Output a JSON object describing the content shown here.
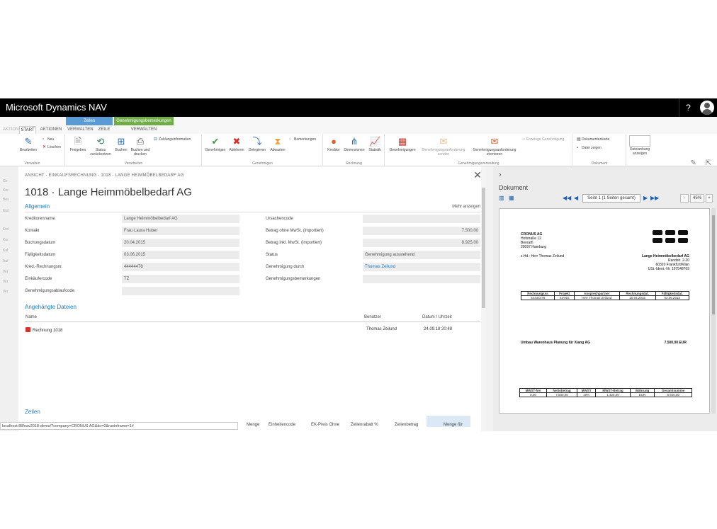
{
  "app": {
    "title": "Microsoft Dynamics NAV",
    "help": "?"
  },
  "ribbon": {
    "context_groups": [
      {
        "label": "Zeilen",
        "color": "#5b9bd5"
      },
      {
        "label": "Genehmigungsbemerkungen",
        "color": "#70ad47"
      }
    ],
    "tabs": [
      "AKTIONEN",
      "START",
      "AKTIONEN",
      "VERWALTEN",
      "ZEILE",
      "VERWALTEN"
    ],
    "groups": {
      "verwalten": {
        "label": "Verwalten",
        "bearbeiten": "Bearbeiten",
        "neu": "Neu",
        "loeschen": "Löschen"
      },
      "verarbeiten": {
        "label": "Verarbeiten",
        "freigeben": "Freigeben",
        "status": "Status zurücksetzen",
        "buchen": "Buchen",
        "buchen_drucken": "Buchen und drucken",
        "zahlungsinfo": "Zahlungsinformation"
      },
      "genehmigen": {
        "label": "Genehmigen",
        "genehmigen": "Genehmigen",
        "ablehnen": "Ablehnen",
        "delegieren": "Delegieren",
        "abwarten": "Abwarten",
        "bemerkungen": "Bemerkungen"
      },
      "rechnung": {
        "label": "Rechnung",
        "kreditor": "Kreditor",
        "dimensionen": "Dimensionen",
        "statistik": "Statistik"
      },
      "genehmigungsverwaltung": {
        "label": "Genehmigungsverwaltung",
        "genehmigungen": "Genehmigungen",
        "senden": "Genehmigungsanforderung senden",
        "stornieren": "Genehmigungsanforderung stornieren",
        "erzwinge": "Erzwinge Genehmigung"
      },
      "dokument": {
        "label": "Dokument",
        "karte": "Dokumentenkarte",
        "datei": "Datei zeigen",
        "anhang": "Dateianhang anzeigen"
      }
    }
  },
  "leftstrip": [
    "Ge",
    "Kre",
    "Bes",
    "Einl",
    "Einl",
    "Kor",
    "Kal",
    "Auf",
    "Ver",
    "Ver",
    "Ver"
  ],
  "card": {
    "breadcrumb": "ANSICHT - EINKAUFSRECHNUNG - 1018 - LANGE HEIMMÖBELBEDARF AG",
    "title": "1018 · Lange Heimmöbelbedarf AG",
    "general_heading": "Allgemein",
    "more": "Mehr anzeigen",
    "fields_left": [
      {
        "label": "Kreditorenname",
        "value": "Lange Heimmöbelbedarf AG"
      },
      {
        "label": "Kontakt",
        "value": "Frau Laura Huber"
      },
      {
        "label": "Buchungsdatum",
        "value": "20.04.2015"
      },
      {
        "label": "Fälligkeitsdatum",
        "value": "03.06.2015"
      },
      {
        "label": "Kred.-Rechnungsnr.",
        "value": "44444478"
      },
      {
        "label": "Einkäufercode",
        "value": "TZ"
      },
      {
        "label": "Genehmigungsablaufcode",
        "value": ""
      }
    ],
    "fields_right": [
      {
        "label": "Ursachencode",
        "value": ""
      },
      {
        "label": "Betrag ohne MwSt. (importiert)",
        "value": "7.500,00"
      },
      {
        "label": "Betrag inkl. MwSt. (importiert)",
        "value": "8.925,00"
      },
      {
        "label": "Status",
        "value": "Genehmigung ausstehend"
      },
      {
        "label": "Genehmigung durch",
        "value": "Thomas Zeilund"
      },
      {
        "label": "Genehmigungsbemerkungen",
        "value": ""
      }
    ],
    "attachments_heading": "Angehängte Dateien",
    "attachments_cols": [
      "Name",
      "Benutzer",
      "Datum / Uhrzeit"
    ],
    "attachments": [
      {
        "name": "Rechnung 1018",
        "user": "Thomas Zeilund",
        "date": "24.09.18 20:48"
      }
    ],
    "lines_heading": "Zeilen",
    "lines_cols": [
      "Menge",
      "Einheitencode",
      "EK-Preis Ohne",
      "Zeilenrabatt %",
      "Zeilenbetrag",
      "Menge für"
    ]
  },
  "statusbar": {
    "url": "localhost:88/nav2018-demo/?company=CRONUS AG&dc=0&runinframe=1#"
  },
  "docpane": {
    "title": "Dokument",
    "page_info": "Seite 1 (1 Seiten gesamt)",
    "zoom": "45%",
    "zoom_minus": "-",
    "zoom_plus": "+",
    "paper": {
      "sender": [
        "CRONUS AG",
        "Hofstraße 12",
        "Benrath",
        "20097 Hamburg"
      ],
      "attn": "z.Hd.: Herr Thomas Zeilund",
      "recipient": [
        "Lange Heimmöbelbedarf AG",
        "Randstr. 2-20",
        "60320 Frankfurt/Main",
        "USt.-Ident.-Nr. 197548769"
      ],
      "t1_head": [
        "Rechnungsnr.",
        "Projekt",
        "Ansprechpartner",
        "Rechnungsdat.",
        "Fälligkeitsdat."
      ],
      "t1_row": [
        "44444478",
        "XIANG",
        "Herr Thomas Zeilund",
        "20.04.2015",
        "03.06.2015"
      ],
      "desc": "Umbau Warenhaus Planung für Xiang AG",
      "amount": "7.500,00 EUR",
      "t2_head": [
        "MWST-frei",
        "Nettobetrag",
        "MWST",
        "MWST-Betrag",
        "Währung",
        "Gesamtsumme"
      ],
      "t2_row": [
        "0,00",
        "7.500,00",
        "19%",
        "1.425,00",
        "EUR",
        "8.925,00"
      ]
    }
  }
}
